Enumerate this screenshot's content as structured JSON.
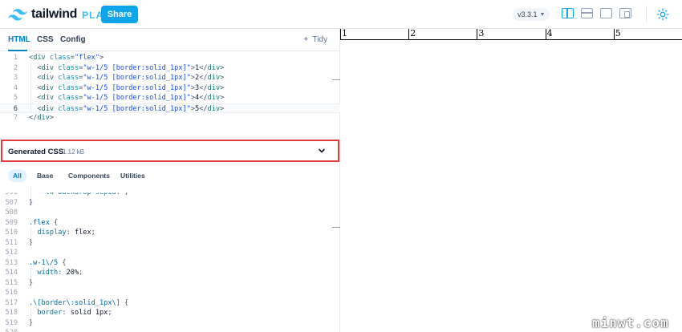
{
  "header": {
    "logo_word": "tailwind",
    "logo_play": "PLAY",
    "share_label": "Share",
    "version": "v3.3.1",
    "accent": "#0ea5e9"
  },
  "editor": {
    "tabs": [
      "HTML",
      "CSS",
      "Config"
    ],
    "active_tab": "HTML",
    "tidy_label": "Tidy",
    "html_lines": [
      {
        "n": "1",
        "text": "<div class=\"flex\">"
      },
      {
        "n": "2",
        "text": "  <div class=\"w-1/5 [border:solid_1px]\">1</div>"
      },
      {
        "n": "3",
        "text": "  <div class=\"w-1/5 [border:solid_1px]\">2</div>"
      },
      {
        "n": "4",
        "text": "  <div class=\"w-1/5 [border:solid_1px]\">3</div>"
      },
      {
        "n": "5",
        "text": "  <div class=\"w-1/5 [border:solid_1px]\">4</div>"
      },
      {
        "n": "6",
        "text": "  <div class=\"w-1/5 [border:solid_1px]\">5</div>"
      },
      {
        "n": "7",
        "text": "</div>"
      }
    ],
    "current_line": "6"
  },
  "generated_css": {
    "title": "Generated CSS",
    "size": "1.12 kB",
    "highlight_color": "#e03a3a",
    "tabs": [
      "All",
      "Base",
      "Components",
      "Utilities"
    ],
    "active_tab": "All",
    "lines": [
      {
        "n": "506",
        "text": "  --tw-backdrop-sepia: ;"
      },
      {
        "n": "507",
        "text": "}"
      },
      {
        "n": "508",
        "text": ""
      },
      {
        "n": "509",
        "text": ".flex {"
      },
      {
        "n": "510",
        "text": "  display: flex;"
      },
      {
        "n": "511",
        "text": "}"
      },
      {
        "n": "512",
        "text": ""
      },
      {
        "n": "513",
        "text": ".w-1\\/5 {"
      },
      {
        "n": "514",
        "text": "  width: 20%;"
      },
      {
        "n": "515",
        "text": "}"
      },
      {
        "n": "516",
        "text": ""
      },
      {
        "n": "517",
        "text": ".\\[border\\:solid_1px\\] {"
      },
      {
        "n": "518",
        "text": "  border: solid 1px;"
      },
      {
        "n": "519",
        "text": "}"
      },
      {
        "n": "520",
        "text": ""
      }
    ]
  },
  "preview": {
    "cells": [
      "1",
      "2",
      "3",
      "4",
      "5"
    ]
  },
  "watermark": "minwt.com",
  "icons": {
    "logo": "tailwind-logo-icon",
    "version_chevron": "chevron-down-icon",
    "layout_buttons": [
      "layout-vertical-icon",
      "layout-horizontal-icon",
      "layout-editor-only-icon",
      "layout-responsive-icon"
    ],
    "theme": "sun-icon",
    "tidy": "sparkle-icon",
    "collapse": "chevron-down-icon"
  }
}
